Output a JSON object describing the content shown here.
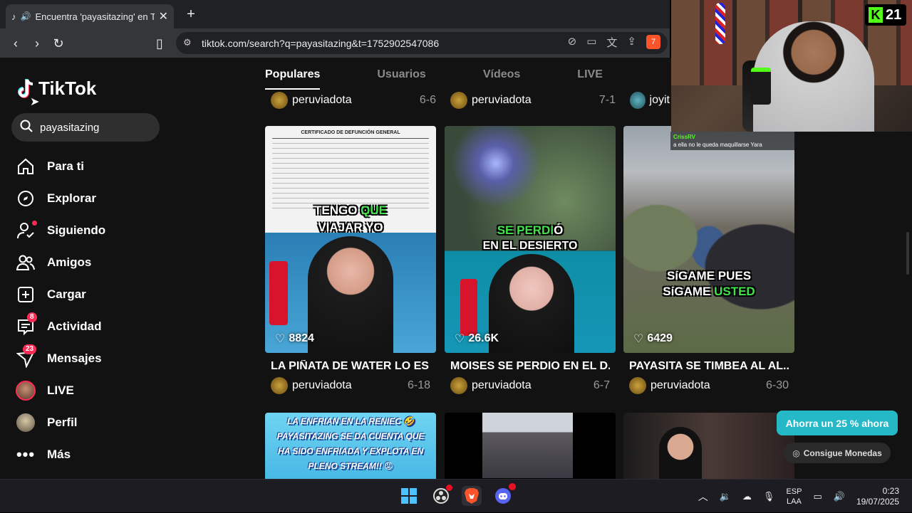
{
  "browser": {
    "tab_title": "Encuentra 'payasitazing' en TikTok",
    "url": "tiktok.com/search?q=payasitazing&t=1752902547086",
    "ext_badge": "7"
  },
  "sidebar": {
    "logo": "TikTok",
    "search_value": "payasitazing",
    "items": [
      {
        "label": "Para ti",
        "icon": "home-icon"
      },
      {
        "label": "Explorar",
        "icon": "compass-icon"
      },
      {
        "label": "Siguiendo",
        "icon": "following-icon"
      },
      {
        "label": "Amigos",
        "icon": "friends-icon"
      },
      {
        "label": "Cargar",
        "icon": "upload-icon"
      },
      {
        "label": "Actividad",
        "icon": "activity-icon",
        "badge": "8"
      },
      {
        "label": "Mensajes",
        "icon": "messages-icon",
        "badge": "23"
      },
      {
        "label": "LIVE",
        "icon": "live-avatar-icon"
      },
      {
        "label": "Perfil",
        "icon": "profile-avatar-icon"
      },
      {
        "label": "Más",
        "icon": "more-icon"
      }
    ]
  },
  "search_tabs": [
    "Populares",
    "Usuarios",
    "Vídeos",
    "LIVE"
  ],
  "top_row": [
    {
      "author": "peruviadota",
      "date": "6-6"
    },
    {
      "author": "peruviadota",
      "date": "7-1"
    },
    {
      "author": "joyit"
    }
  ],
  "videos": [
    {
      "likes": "8824",
      "caption": "LA PIÑATA DE WATER LO ES ...",
      "author": "peruviadota",
      "date": "6-18",
      "overlay_a": "TENGO ",
      "overlay_green": "QUE",
      "overlay_b": "VIAJAR YO",
      "doc_title": "CERTIFICADO DE DEFUNCIÓN GENERAL"
    },
    {
      "likes": "26.6K",
      "caption": "MOISES SE PERDIO EN EL D...",
      "author": "peruviadota",
      "date": "6-7",
      "overlay_green": "SE PERDI",
      "overlay_a": "Ó",
      "overlay_b": "EN EL DESIERTO"
    },
    {
      "likes": "6429",
      "caption": "PAYASITA SE TIMBEA AL AL...",
      "author": "peruviadota",
      "date": "6-30",
      "overlay_a": "SíGAME PUES",
      "overlay_b": "SíGAME ",
      "overlay_green": "USTED",
      "top_user": "CrissRV",
      "top_text": "a ella no le queda maquillarse Yara"
    }
  ],
  "bottom_row": [
    {
      "text": "LA ENFRIAN EN LA RENIEC 🤣 PAYASITAZING SE DA CUENTA QUE HA SIDO ENFRIADA Y EXPLOTA EN PLENO STREAM!! 😡"
    }
  ],
  "promo": {
    "label": "Ahorra un 25 % ahora",
    "coins": "Consigue Monedas"
  },
  "stream_overlay": {
    "kick_count": "21"
  },
  "taskbar": {
    "lang_top": "ESP",
    "lang_bottom": "LAA",
    "time": "0:23",
    "date": "19/07/2025"
  },
  "colors": {
    "accent": "#fe2c55",
    "promo": "#25b8c7",
    "highlight_green": "#41e24a"
  }
}
